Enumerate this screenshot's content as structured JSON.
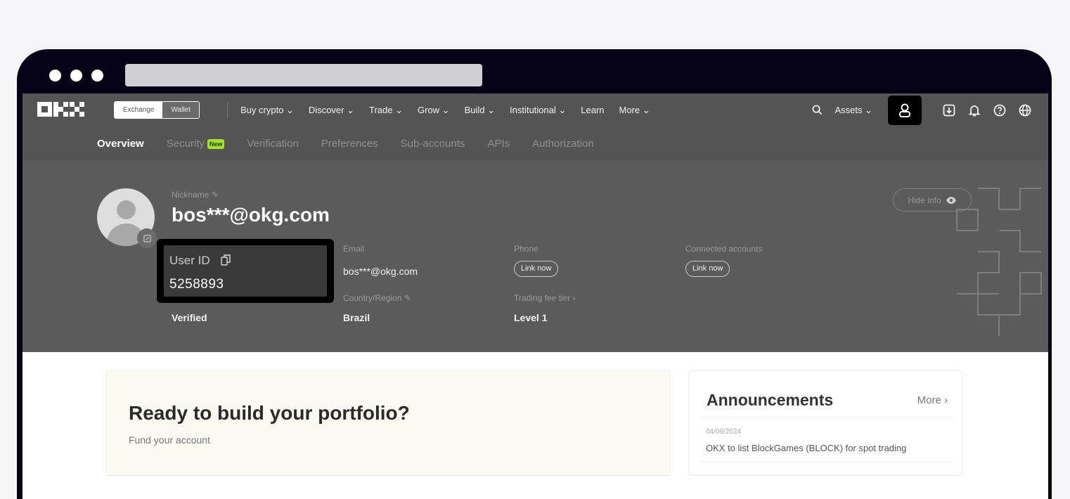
{
  "topnav": {
    "toggle": {
      "exchange": "Exchange",
      "wallet": "Wallet"
    },
    "links": [
      "Buy crypto ⌄",
      "Discover ⌄",
      "Trade ⌄",
      "Grow ⌄",
      "Build ⌄",
      "Institutional ⌄",
      "Learn",
      "More ⌄"
    ],
    "assets": "Assets ⌄"
  },
  "subnav": {
    "tabs": [
      "Overview",
      "Security",
      "Verification",
      "Preferences",
      "Sub-accounts",
      "APIs",
      "Authorization"
    ],
    "new_badge": "New"
  },
  "profile": {
    "nickname_label": "Nickname",
    "nickname": "bos***@okg.com",
    "hide_info": "Hide info",
    "user_id_label": "User ID",
    "user_id": "5258893",
    "verified": "Verified",
    "email_label": "Email",
    "email": "bos***@okg.com",
    "country_label": "Country/Region",
    "country": "Brazil",
    "phone_label": "Phone",
    "phone_link": "Link now",
    "fee_label": "Trading fee tier",
    "fee_value": "Level 1",
    "connected_label": "Connected accounts",
    "connected_link": "Link now"
  },
  "promo": {
    "title": "Ready to build your portfolio?",
    "subtitle": "Fund your account"
  },
  "announcements": {
    "title": "Announcements",
    "more": "More ›",
    "items": [
      {
        "date": "04/09/2024",
        "text": "OKX to list BlockGames (BLOCK) for spot trading"
      }
    ]
  },
  "colors": {
    "nav_bg": "#545454",
    "hero_bg": "#5b5b5b",
    "frame": "#070317",
    "new_badge": "#a6e22e"
  }
}
